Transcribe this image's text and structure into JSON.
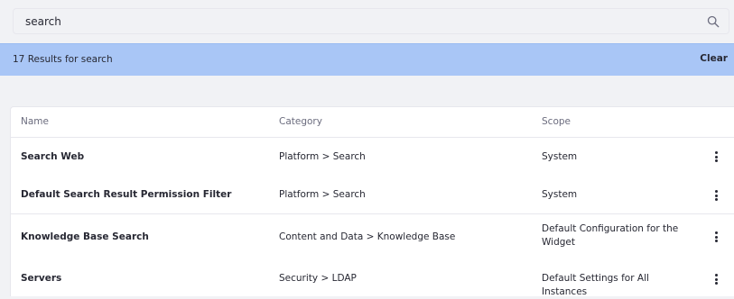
{
  "search": {
    "value": "search",
    "placeholder": "Search",
    "icon": "search-icon"
  },
  "results_bar": {
    "text": "17 Results for search",
    "clear_label": "Clear",
    "background": "#a9c6f6"
  },
  "table": {
    "columns": {
      "name": "Name",
      "category": "Category",
      "scope": "Scope"
    },
    "rows": [
      {
        "name": "Search Web",
        "category": "Platform > Search",
        "scope": "System"
      },
      {
        "name": "Default Search Result Permission Filter",
        "category": "Platform > Search",
        "scope": "System"
      },
      {
        "name": "Knowledge Base Search",
        "category": "Content and Data > Knowledge Base",
        "scope": "Default Configuration for the Widget"
      },
      {
        "name": "Servers",
        "category": "Security > LDAP",
        "scope": "Default Settings for All Instances"
      }
    ],
    "actions_icon": "ellipsis-vertical-icon"
  }
}
